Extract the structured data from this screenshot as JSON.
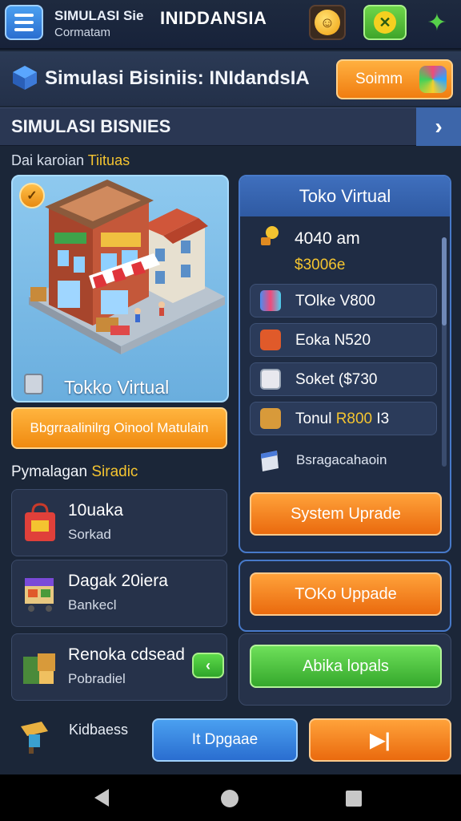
{
  "topbar": {
    "title_a": "SIMULASI Sie",
    "title_b": "INIDDANSIA",
    "subtitle": "Cormatam",
    "icons": [
      "menu-icon",
      "emoji-icon",
      "tool-icon",
      "share-icon"
    ]
  },
  "header": {
    "title": "Simulasi Bisiniis: INIdandsIA",
    "button_label": "Soimm"
  },
  "section": {
    "title": "SIMULASI BISNIES",
    "next_icon": "›"
  },
  "jobs_label": {
    "prefix": "Dai karoian ",
    "highlight": "Tiituas"
  },
  "store_card": {
    "name": "Tokko Virtual",
    "badge": "✓"
  },
  "optimize_button": "Bbgrraalinilrg Oinool Matulain",
  "right_panel": {
    "title": "Toko Virtual",
    "stat_line1": "4040 am",
    "stat_line2": "$3006e",
    "rows": [
      {
        "text": "TOlke V800",
        "icon": "bars-icon"
      },
      {
        "text": "Eoka  N520",
        "icon": "basket-icon"
      },
      {
        "text": "Soket  ($730",
        "icon": "document-icon"
      },
      {
        "text": "Tonul ",
        "highlight": "R800",
        "suffix": "  I3",
        "icon": "box-icon"
      }
    ],
    "misc": "Bsragacahaoin",
    "upgrade_button": "System Uprade"
  },
  "list_label": {
    "prefix": "Pymalagan ",
    "highlight": "Siradic"
  },
  "left_cards": [
    {
      "title": "10uaka",
      "sub": "Sorkad"
    },
    {
      "title": "Dagak 20iera",
      "sub": "Bankecl"
    },
    {
      "title": "Renoka cdsead",
      "sub": "Pobradiel"
    }
  ],
  "toko_upgrade_button": "TOKo Uppade",
  "green_button": "Abika lopals",
  "bottom": {
    "label": "Kidbaess",
    "blue_button": "It Dpgaae",
    "play_button": "▶|"
  },
  "colors": {
    "accent_orange": "#f08a10",
    "accent_blue": "#2f5aa3",
    "accent_green": "#3fa52a",
    "highlight_yellow": "#f4c430",
    "background": "#1b2638"
  }
}
